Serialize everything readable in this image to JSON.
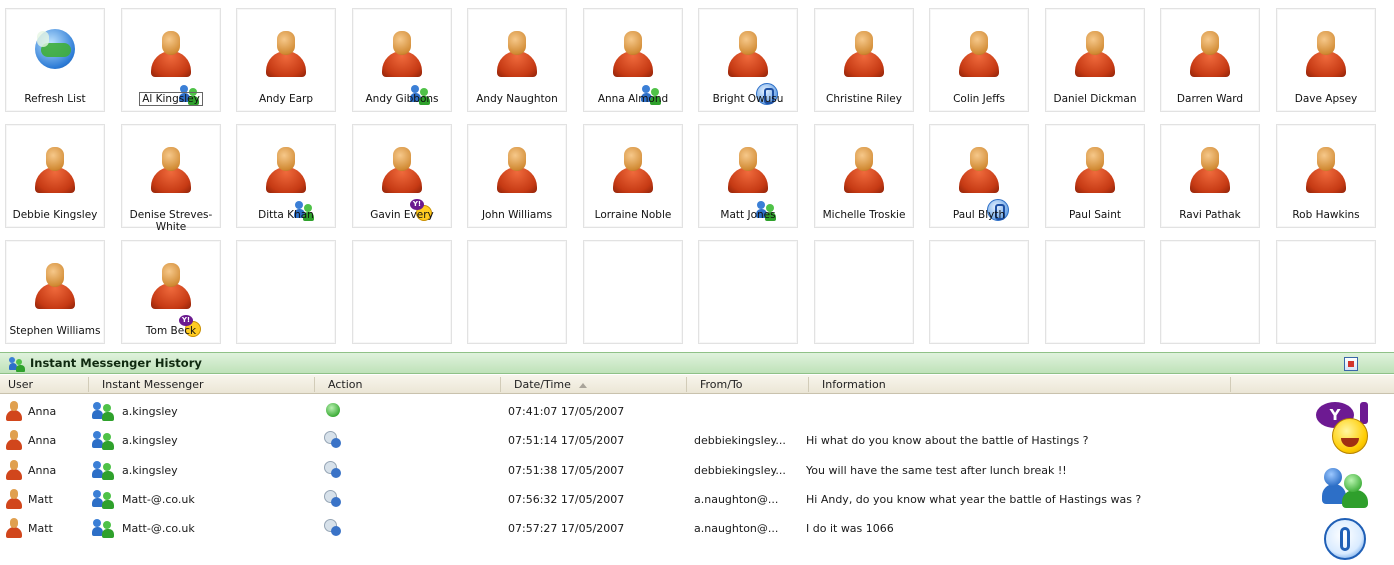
{
  "contacts": {
    "refresh_label": "Refresh List",
    "items": [
      {
        "name": "Al Kingsley",
        "badge": "msn-icon"
      },
      {
        "name": "Andy Earp",
        "badge": ""
      },
      {
        "name": "Andy Gibbons",
        "badge": "msn-icon"
      },
      {
        "name": "Andy Naughton",
        "badge": ""
      },
      {
        "name": "Anna Almond",
        "badge": "msn-icon"
      },
      {
        "name": "Bright Owusu",
        "badge": "aim-icon"
      },
      {
        "name": "Christine Riley",
        "badge": ""
      },
      {
        "name": "Colin Jeffs",
        "badge": ""
      },
      {
        "name": "Daniel Dickman",
        "badge": ""
      },
      {
        "name": "Darren Ward",
        "badge": ""
      },
      {
        "name": "Dave Apsey",
        "badge": ""
      },
      {
        "name": "Debbie Kingsley",
        "badge": ""
      },
      {
        "name": "Denise Streves-White",
        "badge": ""
      },
      {
        "name": "Ditta Khan",
        "badge": "msn-icon"
      },
      {
        "name": "Gavin Every",
        "badge": "yahoo-icon"
      },
      {
        "name": "John Williams",
        "badge": ""
      },
      {
        "name": "Lorraine Noble",
        "badge": ""
      },
      {
        "name": "Matt Jones",
        "badge": "msn-icon"
      },
      {
        "name": "Michelle Troskie",
        "badge": ""
      },
      {
        "name": "Paul Blyth",
        "badge": "aim-icon"
      },
      {
        "name": "Paul Saint",
        "badge": ""
      },
      {
        "name": "Ravi Pathak",
        "badge": ""
      },
      {
        "name": "Rob Hawkins",
        "badge": ""
      },
      {
        "name": "Stephen  Williams",
        "badge": ""
      },
      {
        "name": "Tom Beck",
        "badge": "yahoo-icon"
      }
    ],
    "selected": "Al Kingsley"
  },
  "history": {
    "title": "Instant Messenger History",
    "columns": [
      "User",
      "Instant Messenger",
      "Action",
      "Date/Time",
      "From/To",
      "Information"
    ],
    "sorted_column": "Date/Time",
    "rows": [
      {
        "user": "Anna",
        "messenger": "a.kingsley",
        "action": "login-icon",
        "datetime": "07:41:07 17/05/2007",
        "from_to": "",
        "info": ""
      },
      {
        "user": "Anna",
        "messenger": "a.kingsley",
        "action": "message-icon",
        "datetime": "07:51:14 17/05/2007",
        "from_to": "debbiekingsley...",
        "info": "Hi what do you know about the battle of Hastings ?"
      },
      {
        "user": "Anna",
        "messenger": "a.kingsley",
        "action": "message-icon",
        "datetime": "07:51:38 17/05/2007",
        "from_to": "debbiekingsley...",
        "info": "You will have the same test after lunch break !!"
      },
      {
        "user": "Matt",
        "messenger": "Matt-@.co.uk",
        "action": "message-icon",
        "datetime": "07:56:32 17/05/2007",
        "from_to": "a.naughton@...",
        "info": "Hi Andy, do you know what year the battle of Hastings was ?"
      },
      {
        "user": "Matt",
        "messenger": "Matt-@.co.uk",
        "action": "message-icon",
        "datetime": "07:57:27 17/05/2007",
        "from_to": "a.naughton@...",
        "info": "I do it was 1066"
      }
    ]
  },
  "legend_icons": [
    "yahoo-icon",
    "msn-icon",
    "aim-icon"
  ],
  "colors": {
    "header_green": "#bfe2b9",
    "person_body": "#c63a14",
    "msn_blue": "#2d6fc7",
    "msn_green": "#2fa12c",
    "yahoo_purple": "#6d1a92"
  }
}
